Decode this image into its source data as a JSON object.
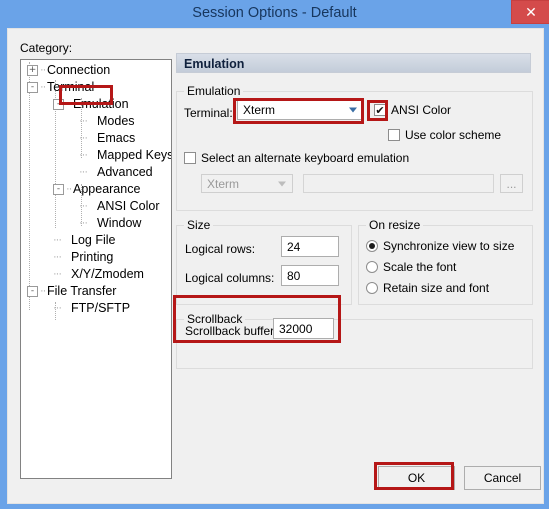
{
  "window": {
    "title": "Session Options - Default",
    "close_icon": "close-icon",
    "close_glyph": "✕",
    "accent_color": "#6aa3e8",
    "annotation_color": "#b51717",
    "close_button_color": "#d44b4b"
  },
  "sidebar": {
    "label": "Category:",
    "items": [
      {
        "label": "Connection",
        "toggle": "+",
        "depth": 0,
        "selected": false
      },
      {
        "label": "Terminal",
        "toggle": "-",
        "depth": 0,
        "selected": false
      },
      {
        "label": "Emulation",
        "toggle": "-",
        "depth": 1,
        "selected": true
      },
      {
        "label": "Modes",
        "toggle": "",
        "depth": 2,
        "selected": false
      },
      {
        "label": "Emacs",
        "toggle": "",
        "depth": 2,
        "selected": false
      },
      {
        "label": "Mapped Keys",
        "toggle": "",
        "depth": 2,
        "selected": false
      },
      {
        "label": "Advanced",
        "toggle": "",
        "depth": 2,
        "selected": false
      },
      {
        "label": "Appearance",
        "toggle": "-",
        "depth": 1,
        "selected": false
      },
      {
        "label": "ANSI Color",
        "toggle": "",
        "depth": 2,
        "selected": false
      },
      {
        "label": "Window",
        "toggle": "",
        "depth": 2,
        "selected": false
      },
      {
        "label": "Log File",
        "toggle": "",
        "depth": 1,
        "selected": false
      },
      {
        "label": "Printing",
        "toggle": "",
        "depth": 1,
        "selected": false
      },
      {
        "label": "X/Y/Zmodem",
        "toggle": "",
        "depth": 1,
        "selected": false
      },
      {
        "label": "File Transfer",
        "toggle": "-",
        "depth": 0,
        "selected": false
      },
      {
        "label": "FTP/SFTP",
        "toggle": "",
        "depth": 1,
        "selected": false
      }
    ]
  },
  "pane": {
    "header": "Emulation",
    "emulation_group": {
      "title": "Emulation",
      "terminal_label": "Terminal:",
      "terminal_value": "Xterm",
      "ansi_color_label": "ANSI Color",
      "ansi_color_checked": true,
      "ansi_color_glyph": "✔",
      "use_color_scheme_label": "Use color scheme",
      "use_color_scheme_checked": false,
      "alternate_keyboard_label": "Select an alternate keyboard emulation",
      "alternate_keyboard_checked": false,
      "alternate_keyboard_value": "Xterm",
      "keymap_file_value": "",
      "keymap_file_placeholder": "",
      "browse_label": "..."
    },
    "size_group": {
      "title": "Size",
      "rows_label": "Logical rows:",
      "rows_value": "24",
      "cols_label": "Logical columns:",
      "cols_value": "80"
    },
    "resize_group": {
      "title": "On resize",
      "options": [
        {
          "label": "Synchronize view to size",
          "selected": true
        },
        {
          "label": "Scale the font",
          "selected": false
        },
        {
          "label": "Retain size and font",
          "selected": false
        }
      ]
    },
    "scrollback_group": {
      "title": "Scrollback",
      "buffer_label": "Scrollback buffer:",
      "buffer_value": "32000"
    }
  },
  "footer": {
    "ok_label": "OK",
    "cancel_label": "Cancel"
  }
}
